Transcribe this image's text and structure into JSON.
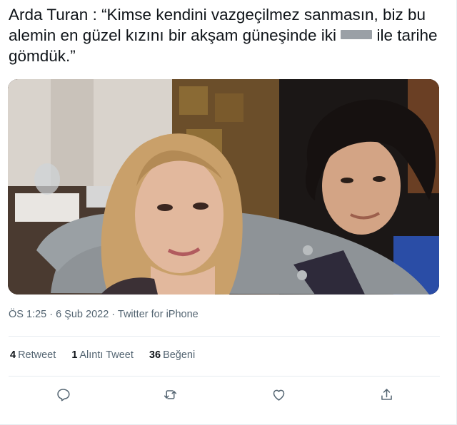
{
  "tweet": {
    "text_part1": "Arda Turan : “Kimse kendini vazgeçilmez sanmasın, biz bu alemin en güzel kızını bir akşam güneşinde iki ",
    "text_part2": " ile tarihe gömdük.”",
    "photo_alt": "",
    "meta": {
      "time": "ÖS 1:25",
      "separator1": " · ",
      "date": "6 Şub 2022",
      "separator2": " · ",
      "source": "Twitter for iPhone"
    },
    "stats": {
      "retweets_count": "4",
      "retweets_label": "Retweet",
      "quotes_count": "1",
      "quotes_label": "Alıntı Tweet",
      "likes_count": "36",
      "likes_label": "Beğeni"
    },
    "actions": {
      "reply_icon": "reply-icon",
      "retweet_icon": "retweet-icon",
      "like_icon": "heart-icon",
      "share_icon": "share-icon"
    }
  },
  "colors": {
    "text": "#0f1419",
    "muted": "#536471",
    "divider": "#e6ecf0"
  }
}
